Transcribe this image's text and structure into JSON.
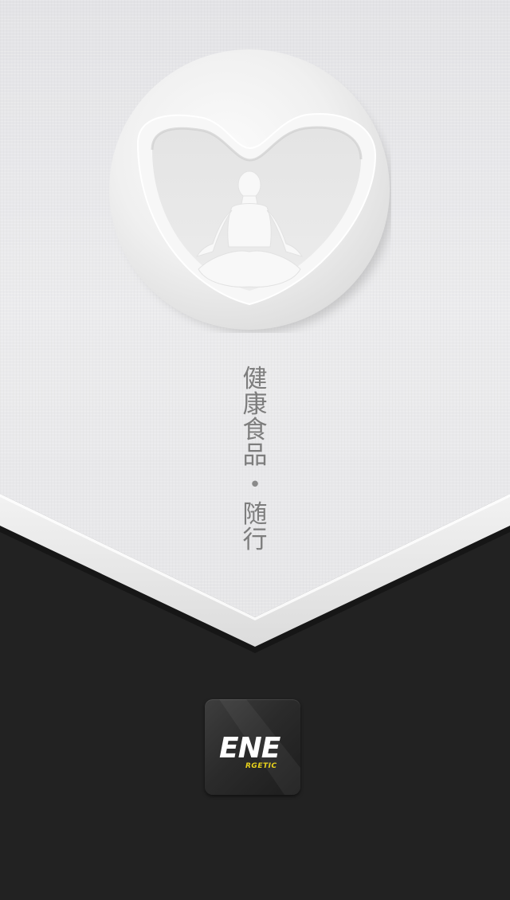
{
  "splash": {
    "emblem_icon": "meditation-heart-icon",
    "tagline_chars": [
      "健",
      "康",
      "食",
      "品"
    ],
    "tagline_separator": "•",
    "tagline_chars_2": [
      "随",
      "行"
    ]
  },
  "app_logo": {
    "icon": "energetic-logo-icon",
    "wordmark_main": "ENE",
    "wordmark_sub": "RGETIC"
  },
  "colors": {
    "paper": "#e9e9eb",
    "dark": "#222222",
    "accent_yellow": "#e8d21c",
    "text_gray": "#7d7d7d"
  }
}
